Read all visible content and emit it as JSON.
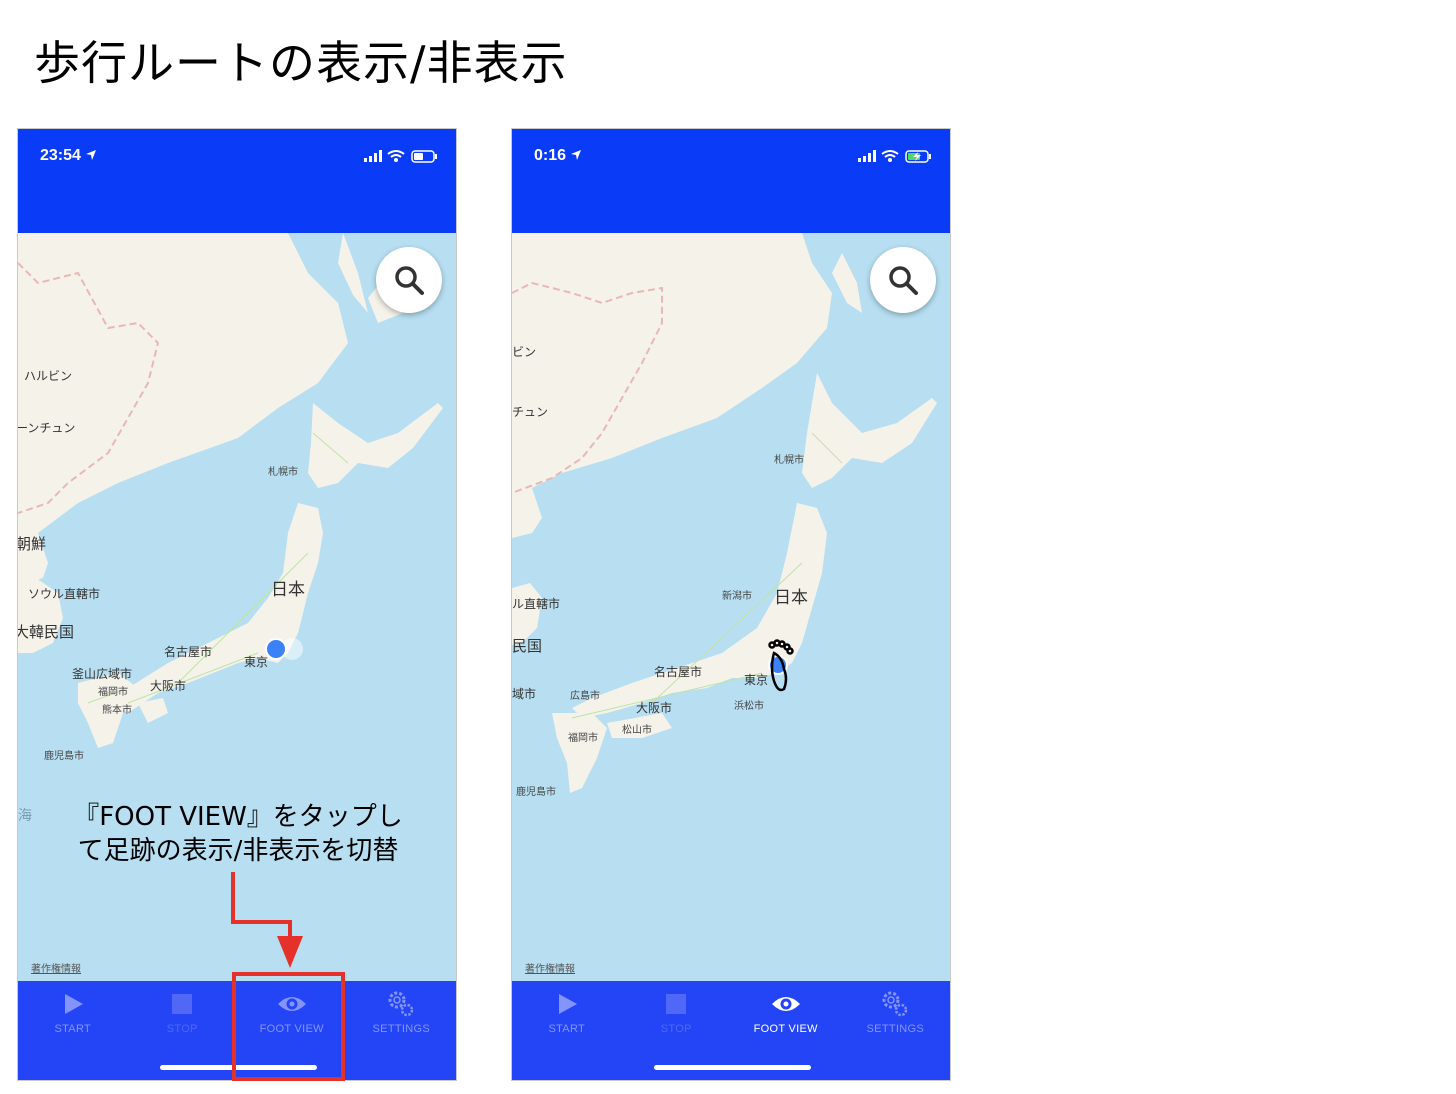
{
  "page": {
    "title": "歩行ルートの表示/非表示"
  },
  "annotation": {
    "text_line1": "『FOOT VIEW』をタップし",
    "text_line2": "て足跡の表示/非表示を切替",
    "highlight_color": "#e4322b"
  },
  "left_screen": {
    "status_time": "23:54",
    "legal_link": "著作権情報",
    "map_labels": {
      "harbin": "ハルビン",
      "changchun": "ーンチュン",
      "sapporo": "札幌市",
      "korea_north": "朝鮮",
      "japan": "日本",
      "seoul": "ソウル直轄市",
      "korea_south": "大韓民国",
      "nagoya": "名古屋市",
      "tokyo": "東京",
      "busan": "釜山広域市",
      "osaka": "大阪市",
      "fukuoka": "福岡市",
      "kumamoto": "熊本市",
      "kagoshima": "鹿児島市",
      "sea": "海"
    },
    "tabs": [
      {
        "label": "START",
        "icon": "play-icon",
        "state": "normal"
      },
      {
        "label": "STOP",
        "icon": "stop-icon",
        "state": "disabled"
      },
      {
        "label": "FOOT VIEW",
        "icon": "eye-icon",
        "state": "normal"
      },
      {
        "label": "SETTINGS",
        "icon": "gears-icon",
        "state": "normal"
      }
    ]
  },
  "right_screen": {
    "status_time": "0:16",
    "legal_link": "著作権情報",
    "map_labels": {
      "harbin": "ビン",
      "changchun": "チュン",
      "sapporo": "札幌市",
      "niigata": "新潟市",
      "japan": "日本",
      "seoul": "ル直轄市",
      "korea_south": "民国",
      "nagoya": "名古屋市",
      "tokyo": "東京",
      "busan": "域市",
      "hiroshima": "広島市",
      "osaka": "大阪市",
      "hamamatsu": "浜松市",
      "fukuoka": "福岡市",
      "matsuyama": "松山市",
      "kagoshima": "鹿児島市"
    },
    "tabs": [
      {
        "label": "START",
        "icon": "play-icon",
        "state": "normal"
      },
      {
        "label": "STOP",
        "icon": "stop-icon",
        "state": "disabled"
      },
      {
        "label": "FOOT VIEW",
        "icon": "eye-icon",
        "state": "active"
      },
      {
        "label": "SETTINGS",
        "icon": "gears-icon",
        "state": "normal"
      }
    ]
  },
  "colors": {
    "header_blue": "#0a3cf8",
    "tabbar_blue": "#2445f6",
    "sea": "#b7dff1",
    "land": "#f5f2ea",
    "location_dot": "#3b82f6"
  }
}
